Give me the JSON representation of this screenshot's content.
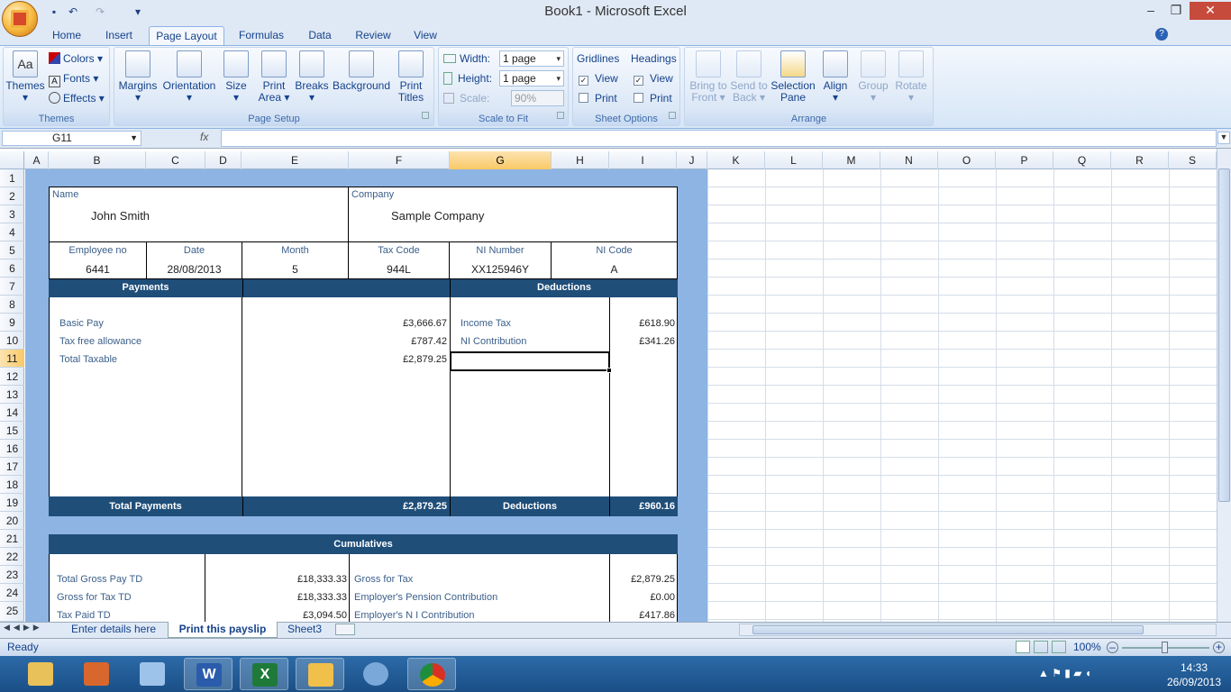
{
  "window": {
    "title": "Book1 - Microsoft Excel"
  },
  "tabs": [
    "Home",
    "Insert",
    "Page Layout",
    "Formulas",
    "Data",
    "Review",
    "View"
  ],
  "ribbon": {
    "themes": {
      "themes_label": "Themes",
      "colors": "Colors",
      "fonts": "Fonts",
      "effects": "Effects",
      "group": "Themes"
    },
    "page_setup": {
      "margins": "Margins",
      "orientation": "Orientation",
      "size": "Size",
      "print_area_1": "Print",
      "print_area_2": "Area",
      "breaks": "Breaks",
      "background": "Background",
      "print_titles_1": "Print",
      "print_titles_2": "Titles",
      "group": "Page Setup"
    },
    "scale": {
      "width_label": "Width:",
      "width_value": "1 page",
      "height_label": "Height:",
      "height_value": "1 page",
      "scale_label": "Scale:",
      "scale_value": "90%",
      "group": "Scale to Fit"
    },
    "sheet_options": {
      "gridlines": "Gridlines",
      "headings": "Headings",
      "view": "View",
      "print": "Print",
      "group": "Sheet Options"
    },
    "arrange": {
      "bring_1": "Bring to",
      "bring_2": "Front",
      "send_1": "Send to",
      "send_2": "Back",
      "selection_1": "Selection",
      "selection_2": "Pane",
      "align": "Align",
      "group_btn": "Group",
      "rotate": "Rotate",
      "group": "Arrange"
    }
  },
  "formula_bar": {
    "name_box": "G11",
    "fx": "fx",
    "content": ""
  },
  "columns": [
    "A",
    "B",
    "C",
    "D",
    "E",
    "F",
    "G",
    "H",
    "I",
    "J",
    "K",
    "L",
    "M",
    "N",
    "O",
    "P",
    "Q",
    "R",
    "S"
  ],
  "rows": [
    "1",
    "2",
    "3",
    "4",
    "5",
    "6",
    "7",
    "8",
    "9",
    "10",
    "11",
    "12",
    "13",
    "14",
    "15",
    "16",
    "17",
    "18",
    "19",
    "20",
    "21",
    "22",
    "23",
    "24",
    "25"
  ],
  "payslip": {
    "name_label": "Name",
    "name": "John Smith",
    "company_label": "Company",
    "company": "Sample Company",
    "emp_no_label": "Employee no",
    "emp_no": "6441",
    "date_label": "Date",
    "date": "28/08/2013",
    "month_label": "Month",
    "month": "5",
    "tax_code_label": "Tax Code",
    "tax_code": "944L",
    "ni_number_label": "NI Number",
    "ni_number": "XX125946Y",
    "ni_code_label": "NI Code",
    "ni_code": "A",
    "payments_header": "Payments",
    "deductions_header": "Deductions",
    "basic_pay_label": "Basic Pay",
    "basic_pay": "£3,666.67",
    "tax_free_label": "Tax free allowance",
    "tax_free": "£787.42",
    "total_taxable_label": "Total Taxable",
    "total_taxable": "£2,879.25",
    "income_tax_label": "Income Tax",
    "income_tax": "£618.90",
    "ni_contrib_label": "NI Contribution",
    "ni_contrib": "£341.26",
    "total_payments_label": "Total Payments",
    "total_payments": "£2,879.25",
    "deductions_label": "Deductions",
    "deductions_total": "£960.16",
    "cumulatives_header": "Cumulatives",
    "gross_pay_td_label": "Total Gross Pay TD",
    "gross_pay_td": "£18,333.33",
    "gross_tax_td_label": "Gross for Tax TD",
    "gross_tax_td": "£18,333.33",
    "tax_paid_td_label": "Tax Paid TD",
    "tax_paid_td": "£3,094.50",
    "gross_for_tax_label": "Gross for Tax",
    "gross_for_tax": "£2,879.25",
    "employer_pension_label": "Employer's Pension Contribution",
    "employer_pension": "£0.00",
    "employer_ni_label": "Employer's N I Contribution",
    "employer_ni": "£417.86"
  },
  "sheets": [
    "Enter details here",
    "Print this payslip",
    "Sheet3"
  ],
  "status": {
    "ready": "Ready",
    "zoom": "100%"
  },
  "clock": {
    "time": "14:33",
    "date": "26/09/2013"
  }
}
